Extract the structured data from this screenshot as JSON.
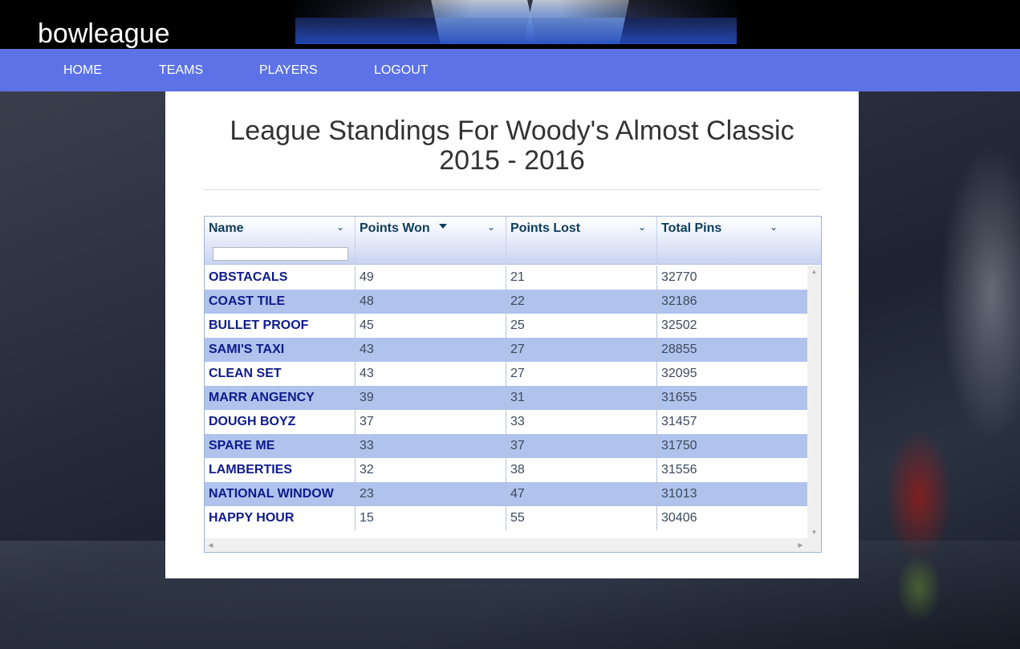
{
  "app": {
    "brand": "bowleague"
  },
  "nav": {
    "items": [
      {
        "label": "HOME"
      },
      {
        "label": "TEAMS"
      },
      {
        "label": "PLAYERS"
      },
      {
        "label": "LOGOUT"
      }
    ]
  },
  "page": {
    "title": "League Standings For Woody's Almost Classic 2015 - 2016"
  },
  "grid": {
    "columns": [
      {
        "label": "Name",
        "filter_value": ""
      },
      {
        "label": "Points Won",
        "sorted": "descending"
      },
      {
        "label": "Points Lost"
      },
      {
        "label": "Total Pins"
      }
    ],
    "rows": [
      {
        "name": "OBSTACALS",
        "won": "49",
        "lost": "21",
        "pins": "32770"
      },
      {
        "name": "COAST TILE",
        "won": "48",
        "lost": "22",
        "pins": "32186"
      },
      {
        "name": "BULLET PROOF",
        "won": "45",
        "lost": "25",
        "pins": "32502"
      },
      {
        "name": "SAMI'S TAXI",
        "won": "43",
        "lost": "27",
        "pins": "28855"
      },
      {
        "name": "CLEAN SET",
        "won": "43",
        "lost": "27",
        "pins": "32095"
      },
      {
        "name": "MARR ANGENCY",
        "won": "39",
        "lost": "31",
        "pins": "31655"
      },
      {
        "name": "DOUGH BOYZ",
        "won": "37",
        "lost": "33",
        "pins": "31457"
      },
      {
        "name": "SPARE ME",
        "won": "33",
        "lost": "37",
        "pins": "31750"
      },
      {
        "name": "LAMBERTIES",
        "won": "32",
        "lost": "38",
        "pins": "31556"
      },
      {
        "name": "NATIONAL WINDOW",
        "won": "23",
        "lost": "47",
        "pins": "31013"
      },
      {
        "name": "HAPPY HOUR",
        "won": "15",
        "lost": "55",
        "pins": "30406"
      }
    ]
  },
  "colors": {
    "navbar": "#5c72e6",
    "row_alt": "#b0c3ec",
    "name_text": "#0f1a8c"
  },
  "icons": {
    "column_menu": "chevron-down-icon",
    "sort": "sort-descending-icon"
  }
}
